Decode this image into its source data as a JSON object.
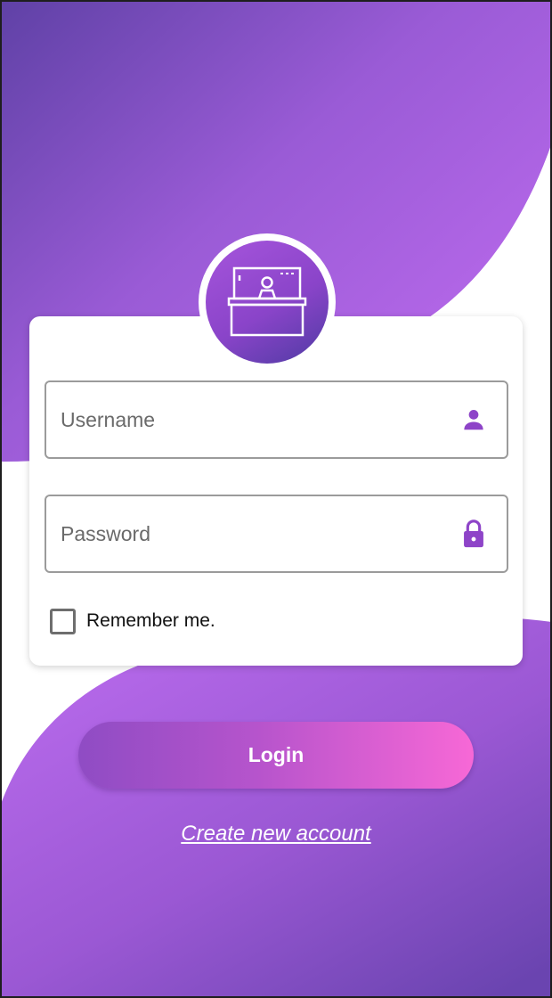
{
  "login_form": {
    "username": {
      "placeholder": "Username",
      "value": "",
      "icon": "person-icon"
    },
    "password": {
      "placeholder": "Password",
      "value": "",
      "icon": "lock-icon"
    },
    "remember_me": {
      "label": "Remember me.",
      "checked": false
    }
  },
  "actions": {
    "login_label": "Login",
    "create_account_label": "Create new account"
  },
  "logo": {
    "icon": "reception-desk-icon"
  },
  "colors": {
    "accent": "#8e44c8",
    "gradient_top": "#5e3fa8",
    "gradient_mid": "#b968ea",
    "button_start": "#8f4cc4",
    "button_end": "#f768d6"
  }
}
